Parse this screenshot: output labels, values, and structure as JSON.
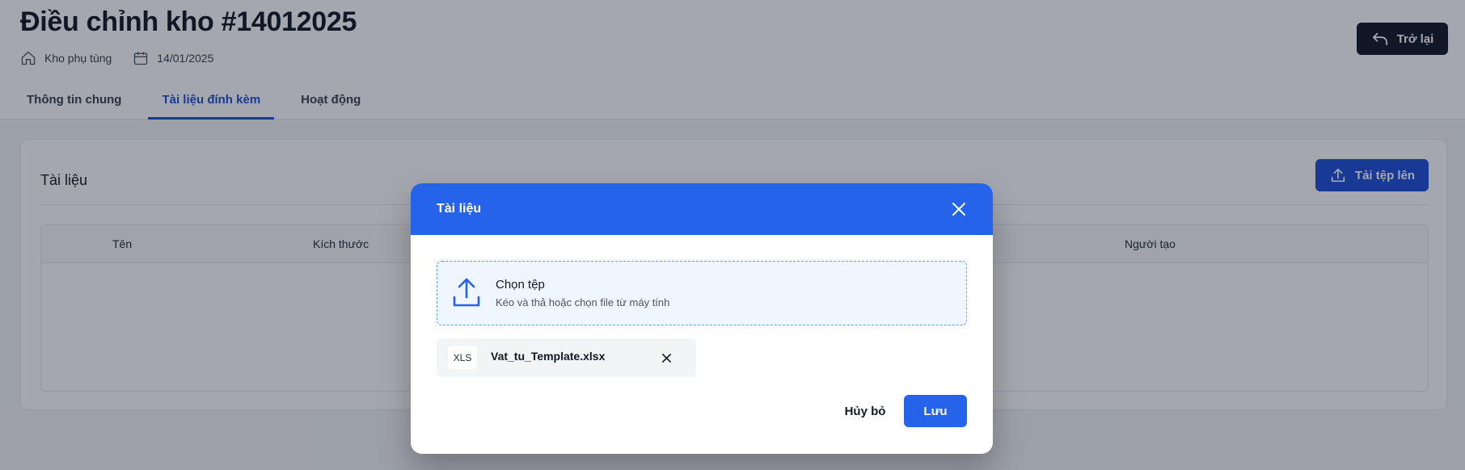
{
  "header": {
    "title": "Điều chỉnh kho #14012025",
    "warehouse": "Kho phụ tùng",
    "date": "14/01/2025",
    "back_label": "Trở lại"
  },
  "tabs": [
    {
      "label": "Thông tin chung",
      "active": false
    },
    {
      "label": "Tài liệu đính kèm",
      "active": true
    },
    {
      "label": "Hoạt động",
      "active": false
    }
  ],
  "documents": {
    "title": "Tài liệu",
    "upload_label": "Tải tệp lên",
    "columns": [
      "",
      "Tên",
      "Kích thước",
      "Người tạo"
    ]
  },
  "modal": {
    "title": "Tài liệu",
    "dropzone_title": "Chọn tệp",
    "dropzone_hint": "Kéo và thả hoặc chọn file từ máy tính",
    "file": {
      "type": "XLS",
      "name": "Vat_tu_Template.xlsx"
    },
    "cancel_label": "Hủy bỏ",
    "save_label": "Lưu"
  },
  "icons": {
    "home": "home-icon",
    "calendar": "calendar-icon",
    "back": "undo-arrow-icon",
    "upload": "upload-icon",
    "close": "close-icon",
    "remove": "close-icon"
  },
  "colors": {
    "primary": "#2563eb",
    "tab_active": "#1d4ed8",
    "dark_button": "#111827",
    "overlay": "rgba(17,24,39,0.38)"
  }
}
